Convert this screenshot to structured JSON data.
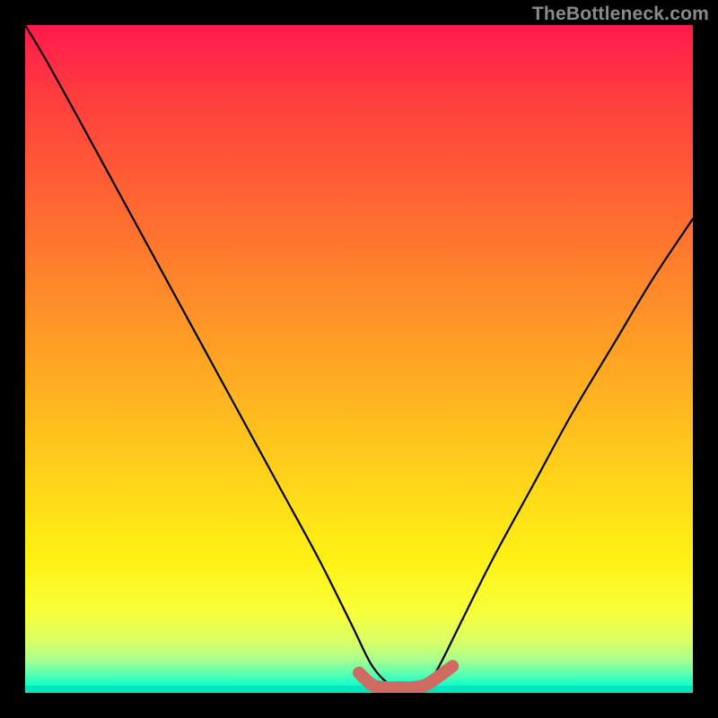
{
  "watermark": "TheBottleneck.com",
  "chart_data": {
    "type": "line",
    "title": "",
    "xlabel": "",
    "ylabel": "",
    "xlim": [
      0,
      100
    ],
    "ylim": [
      0,
      100
    ],
    "series": [
      {
        "name": "bottleneck-curve",
        "x": [
          0,
          3,
          8,
          14,
          20,
          26,
          32,
          38,
          44,
          49,
          52,
          55,
          58,
          60,
          62,
          65,
          70,
          76,
          82,
          88,
          94,
          100
        ],
        "values": [
          100,
          95,
          86,
          75,
          64,
          53,
          42,
          31,
          20,
          10,
          4,
          1,
          0.5,
          1,
          4,
          10,
          20,
          31,
          42,
          52,
          62,
          71
        ]
      },
      {
        "name": "optimal-range-marker",
        "x": [
          50,
          52,
          54,
          56,
          58,
          60,
          62,
          64
        ],
        "values": [
          3,
          1.2,
          0.8,
          0.8,
          0.8,
          1.2,
          2.5,
          4
        ]
      }
    ],
    "colors": {
      "gradient_top": "#ff1a4d",
      "gradient_mid": "#ffd919",
      "gradient_bottom": "#00f7c8",
      "curve": "#000000",
      "marker": "#cf6b62"
    }
  }
}
